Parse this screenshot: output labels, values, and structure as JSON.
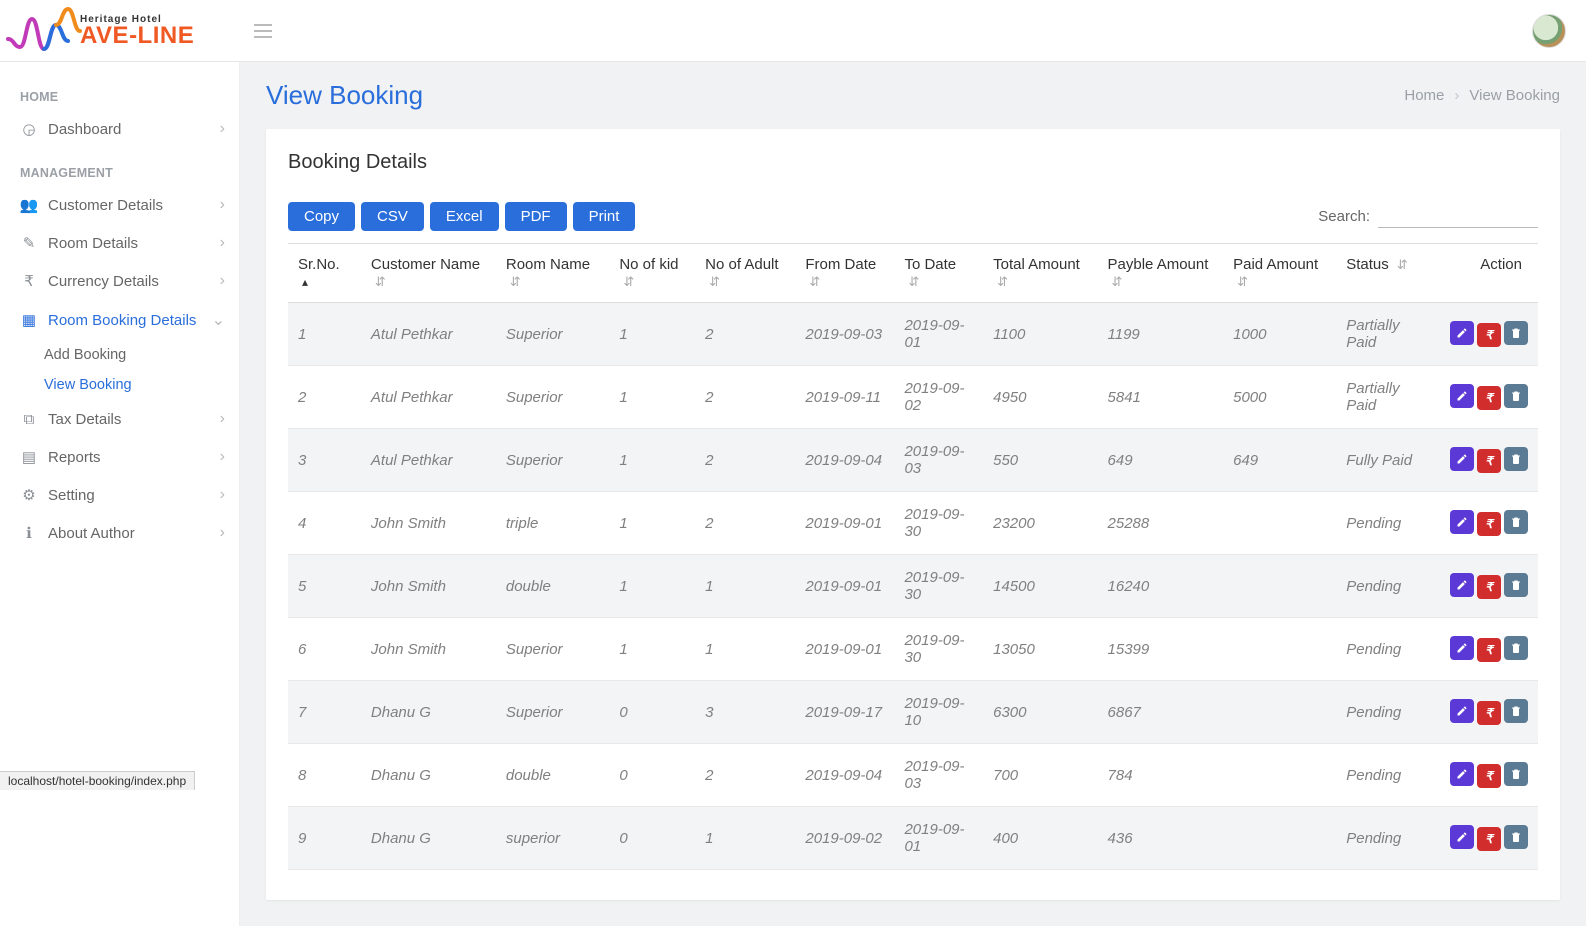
{
  "brand": {
    "small": "Heritage  Hotel",
    "main": "AVE-LINE"
  },
  "header": {
    "title": "View Booking",
    "breadcrumb": [
      "Home",
      "View Booking"
    ]
  },
  "sidebar": {
    "groups": [
      {
        "label": "HOME",
        "items": [
          {
            "icon": "dashboard",
            "label": "Dashboard",
            "chev": true
          }
        ]
      },
      {
        "label": "MANAGEMENT",
        "items": [
          {
            "icon": "users",
            "label": "Customer Details",
            "chev": true
          },
          {
            "icon": "edit",
            "label": "Room Details",
            "chev": true
          },
          {
            "icon": "rupee",
            "label": "Currency Details",
            "chev": true
          },
          {
            "icon": "grid",
            "label": "Room Booking Details",
            "chev": true,
            "active": true,
            "sub": [
              {
                "label": "Add Booking"
              },
              {
                "label": "View Booking",
                "active": true
              }
            ]
          },
          {
            "icon": "copy",
            "label": "Tax Details",
            "chev": true
          },
          {
            "icon": "report",
            "label": "Reports",
            "chev": true
          },
          {
            "icon": "gear",
            "label": "Setting",
            "chev": true
          },
          {
            "icon": "info",
            "label": "About Author",
            "chev": true
          }
        ]
      }
    ]
  },
  "panel_title": "Booking Details",
  "export_buttons": [
    "Copy",
    "CSV",
    "Excel",
    "PDF",
    "Print"
  ],
  "search_label": "Search:",
  "columns": [
    "Sr.No.",
    "Customer Name",
    "Room Name",
    "No of kid",
    "No of Adult",
    "From Date",
    "To Date",
    "Total Amount",
    "Payble Amount",
    "Paid Amount",
    "Status",
    "Action"
  ],
  "rows": [
    {
      "sr": "1",
      "customer": "Atul Pethkar",
      "room": "Superior",
      "kid": "1",
      "adult": "2",
      "from": "2019-09-03",
      "to": "2019-09-01",
      "total": "1100",
      "payable": "1199",
      "paid": "1000",
      "status": "Partially Paid"
    },
    {
      "sr": "2",
      "customer": "Atul Pethkar",
      "room": "Superior",
      "kid": "1",
      "adult": "2",
      "from": "2019-09-11",
      "to": "2019-09-02",
      "total": "4950",
      "payable": "5841",
      "paid": "5000",
      "status": "Partially Paid"
    },
    {
      "sr": "3",
      "customer": "Atul Pethkar",
      "room": "Superior",
      "kid": "1",
      "adult": "2",
      "from": "2019-09-04",
      "to": "2019-09-03",
      "total": "550",
      "payable": "649",
      "paid": "649",
      "status": "Fully Paid"
    },
    {
      "sr": "4",
      "customer": "John Smith",
      "room": "triple",
      "kid": "1",
      "adult": "2",
      "from": "2019-09-01",
      "to": "2019-09-30",
      "total": "23200",
      "payable": "25288",
      "paid": "",
      "status": "Pending"
    },
    {
      "sr": "5",
      "customer": "John Smith",
      "room": "double",
      "kid": "1",
      "adult": "1",
      "from": "2019-09-01",
      "to": "2019-09-30",
      "total": "14500",
      "payable": "16240",
      "paid": "",
      "status": "Pending"
    },
    {
      "sr": "6",
      "customer": "John Smith",
      "room": "Superior",
      "kid": "1",
      "adult": "1",
      "from": "2019-09-01",
      "to": "2019-09-30",
      "total": "13050",
      "payable": "15399",
      "paid": "",
      "status": "Pending"
    },
    {
      "sr": "7",
      "customer": "Dhanu G",
      "room": "Superior",
      "kid": "0",
      "adult": "3",
      "from": "2019-09-17",
      "to": "2019-09-10",
      "total": "6300",
      "payable": "6867",
      "paid": "",
      "status": "Pending"
    },
    {
      "sr": "8",
      "customer": "Dhanu G",
      "room": "double",
      "kid": "0",
      "adult": "2",
      "from": "2019-09-04",
      "to": "2019-09-03",
      "total": "700",
      "payable": "784",
      "paid": "",
      "status": "Pending"
    },
    {
      "sr": "9",
      "customer": "Dhanu G",
      "room": "superior",
      "kid": "0",
      "adult": "1",
      "from": "2019-09-02",
      "to": "2019-09-01",
      "total": "400",
      "payable": "436",
      "paid": "",
      "status": "Pending"
    }
  ],
  "status_bar": "localhost/hotel-booking/index.php"
}
